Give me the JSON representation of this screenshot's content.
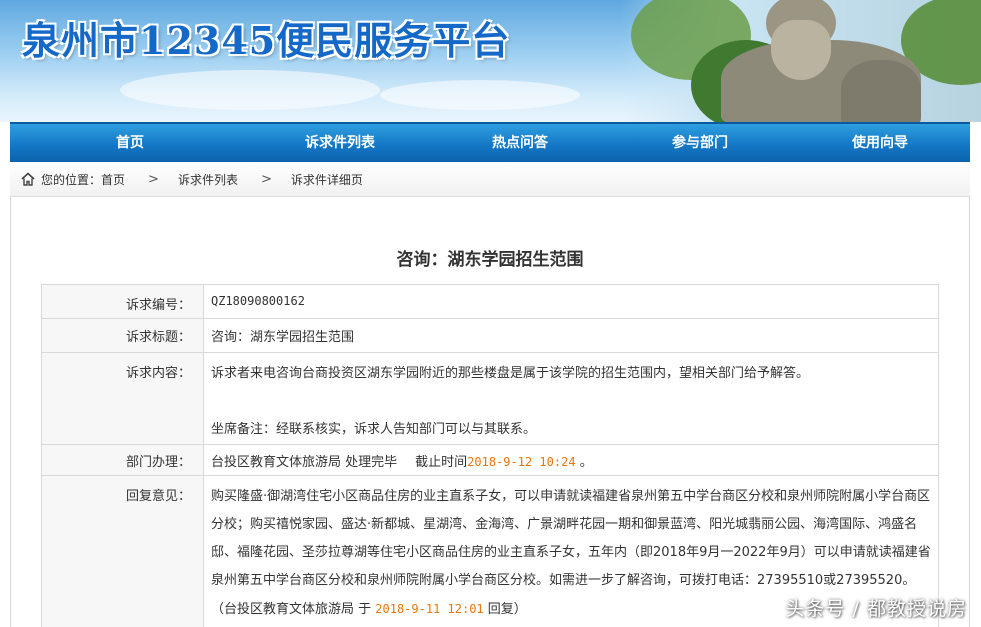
{
  "header": {
    "title": "泉州市12345便民服务平台",
    "colors": {
      "title": "#1468c8",
      "banner_top": "#5fa8e0",
      "nav": "#1478c6"
    }
  },
  "nav": {
    "items": [
      {
        "label": "首页"
      },
      {
        "label": "诉求件列表"
      },
      {
        "label": "热点问答"
      },
      {
        "label": "参与部门"
      },
      {
        "label": "使用向导"
      }
    ]
  },
  "breadcrumb": {
    "icon": "home-icon",
    "prefix": "您的位置：",
    "items": [
      {
        "label": "首页"
      },
      {
        "label": "诉求件列表"
      },
      {
        "label": "诉求件详细页"
      }
    ],
    "separator": ">"
  },
  "detail": {
    "heading": "咨询：湖东学园招生范围",
    "number_label": "诉求编号：",
    "number_value": "QZ18090800162",
    "title_label": "诉求标题：",
    "title_value": "咨询：湖东学园招生范围",
    "content_label": "诉求内容：",
    "content_line1": "诉求者来电咨询台商投资区湖东学园附近的那些楼盘是属于该学院的招生范围内，望相关部门给予解答。",
    "content_line2": "坐席备注：经联系核实，诉求人告知部门可以与其联系。",
    "dept_label": "部门办理：",
    "dept_name": "台投区教育文体旅游局",
    "dept_status": "处理完毕",
    "deadline_label": "截止时间",
    "deadline_value": "2018-9-12 10:24",
    "deadline_suffix": "。",
    "reply_label": "回复意见：",
    "reply_text": "购买隆盛·御湖湾住宅小区商品住房的业主直系子女，可以申请就读福建省泉州第五中学台商区分校和泉州师院附属小学台商区分校；购买禧悦家园、盛达·新都城、星湖湾、金海湾、广景湖畔花园一期和御景蓝湾、阳光城翡丽公园、海湾国际、鸿盛名邸、福隆花园、圣莎拉尊湖等住宅小区商品住房的业主直系子女，五年内（即2018年9月一2022年9月）可以申请就读福建省泉州第五中学台商区分校和泉州师院附属小学台商区分校。如需进一步了解咨询，可拨打电话：27395510或27395520。（台投区教育文体旅游局 于",
    "reply_time": "2018-9-11 12:01",
    "reply_suffix": "回复）"
  },
  "watermark": "头条号 / 都教授说房"
}
